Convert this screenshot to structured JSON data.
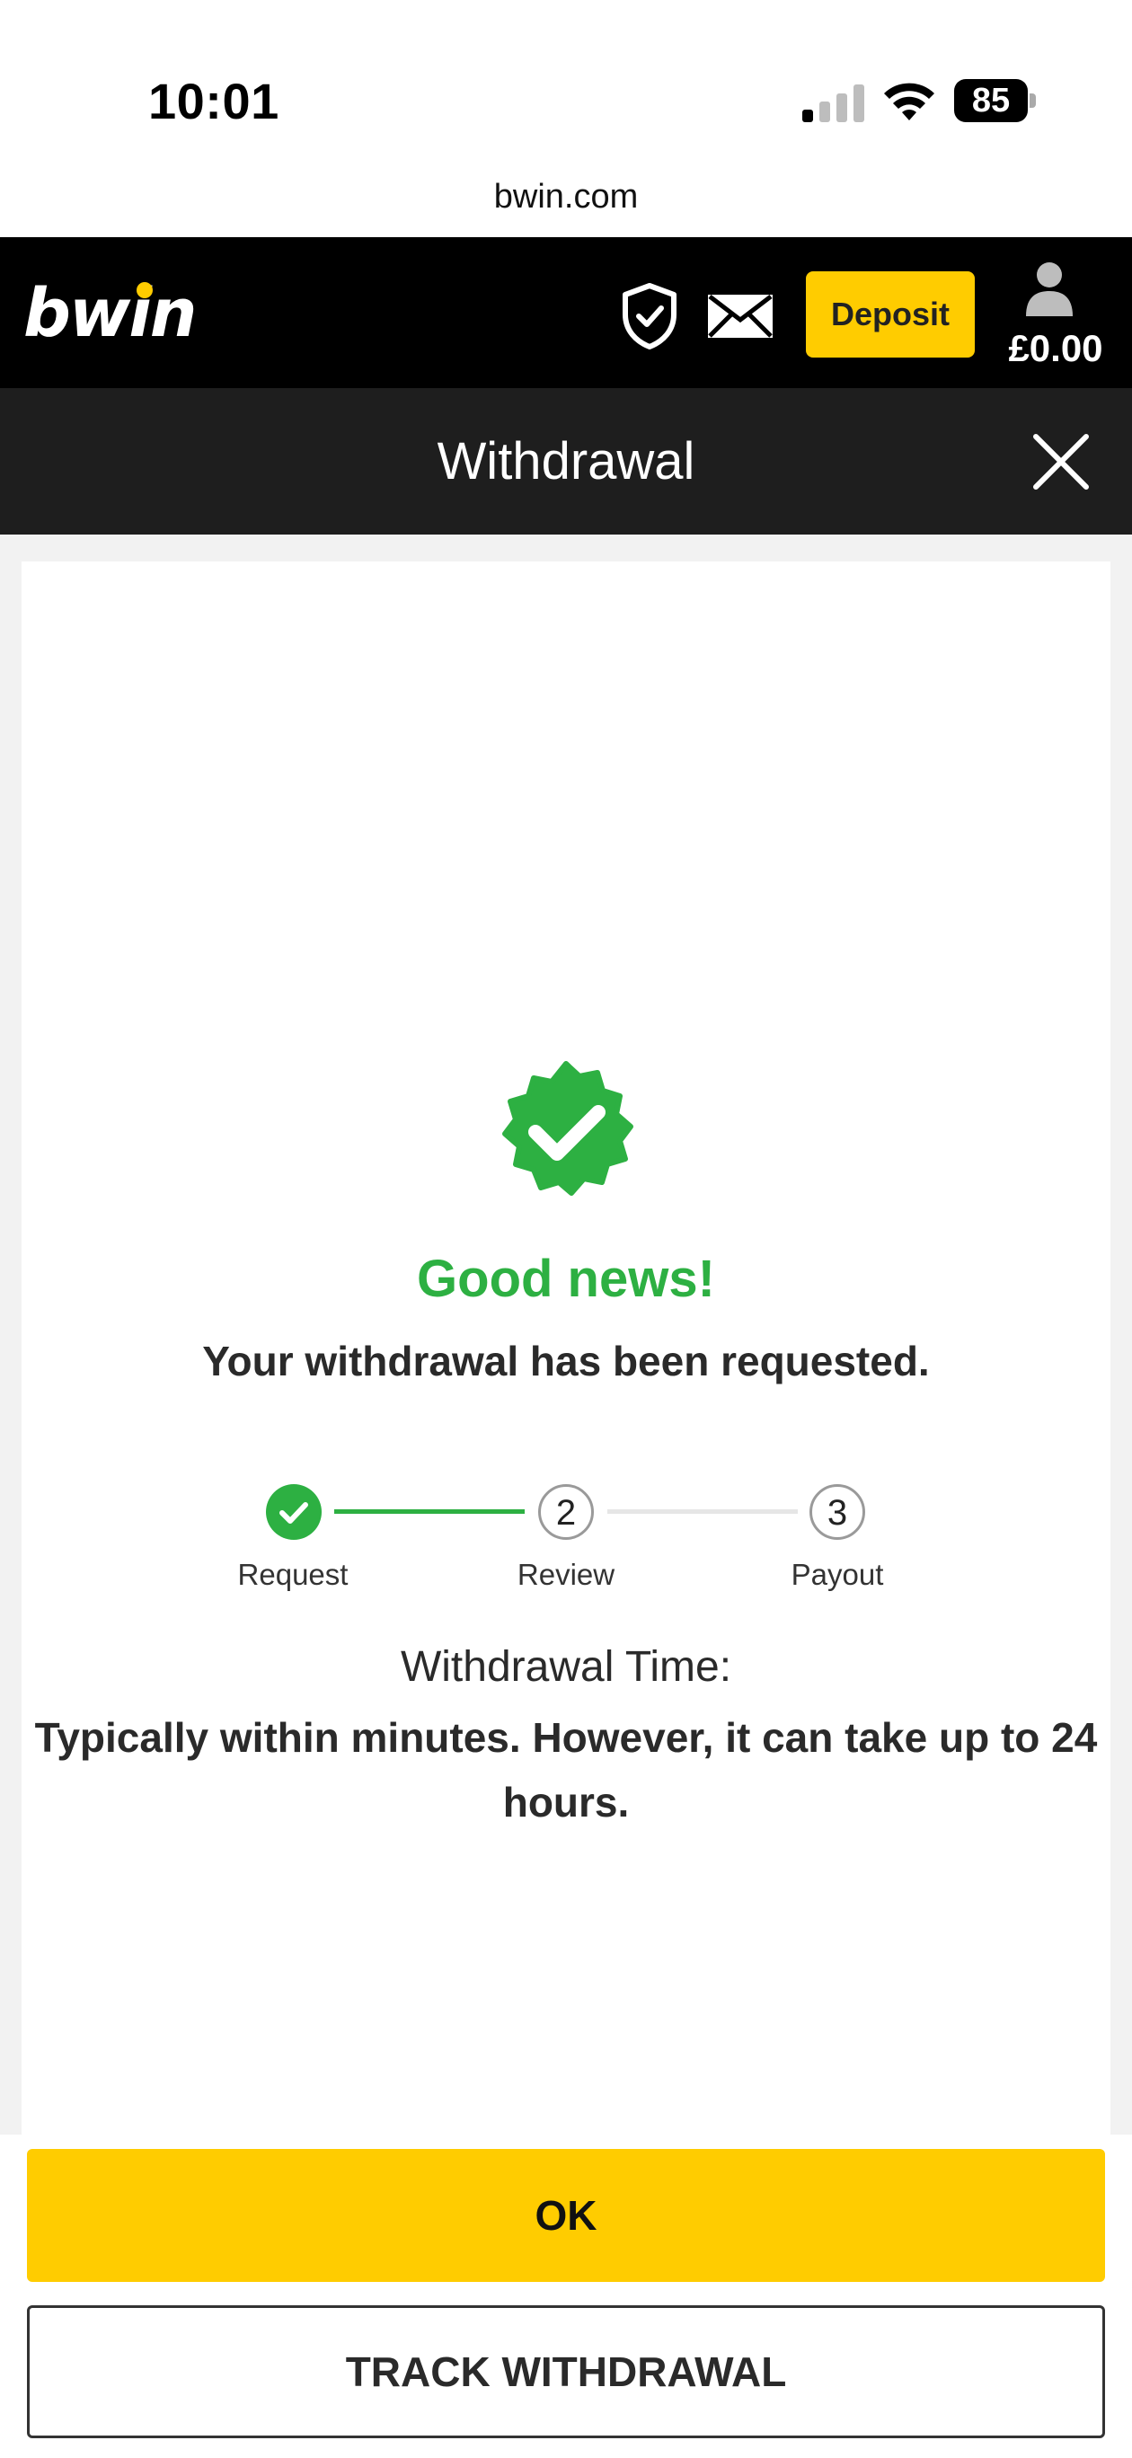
{
  "status_bar": {
    "time": "10:01",
    "battery": "85",
    "icons": [
      "signal-icon",
      "wifi-icon",
      "battery-icon"
    ]
  },
  "browser": {
    "url": "bwin.com"
  },
  "topnav": {
    "logo": "bwin",
    "icons": [
      "shield-check-icon",
      "mail-icon",
      "user-icon"
    ],
    "deposit_label": "Deposit",
    "balance": "£0.00",
    "brand_color": "#ffcc00"
  },
  "header": {
    "title": "Withdrawal",
    "close_icon": "close-icon"
  },
  "confirmation": {
    "badge_icon": "verified-badge-icon",
    "headline": "Good news!",
    "message": "Your withdrawal has been requested.",
    "success_color": "#2db042"
  },
  "stepper": {
    "steps": [
      {
        "number": "1",
        "label": "Request",
        "status": "done"
      },
      {
        "number": "2",
        "label": "Review",
        "status": "pending"
      },
      {
        "number": "3",
        "label": "Payout",
        "status": "pending"
      }
    ]
  },
  "withdrawal_time": {
    "label": "Withdrawal Time:",
    "value": "Typically within minutes. However, it can take up to 24 hours."
  },
  "actions": {
    "ok_label": "OK",
    "track_label": "TRACK WITHDRAWAL"
  }
}
